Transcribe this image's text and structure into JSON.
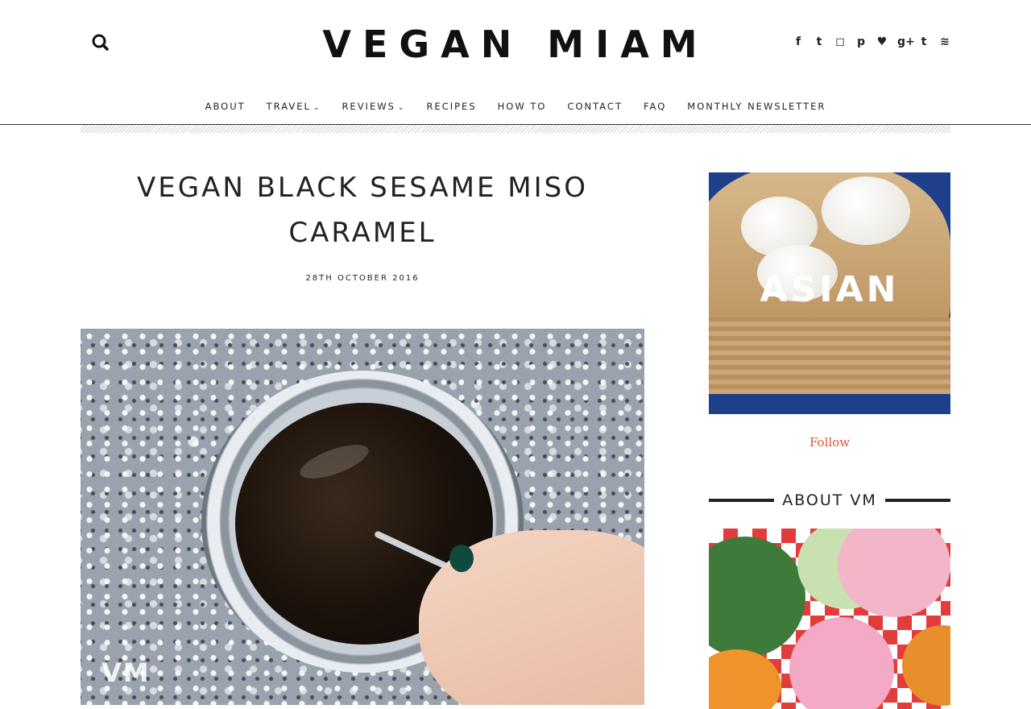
{
  "header": {
    "logo_text": "VEGAN MIAM",
    "search_icon": "search-icon",
    "social_icons": [
      "facebook-icon",
      "twitter-icon",
      "instagram-icon",
      "pinterest-icon",
      "bloglovin-heart-icon",
      "google-plus-icon",
      "tumblr-icon",
      "rss-icon"
    ],
    "social_glyphs": [
      "f",
      "t",
      "◻",
      "p",
      "♥",
      "g+",
      "t",
      "≋"
    ]
  },
  "nav": {
    "items": [
      {
        "label": "ABOUT",
        "dropdown": false
      },
      {
        "label": "TRAVEL",
        "dropdown": true
      },
      {
        "label": "REVIEWS",
        "dropdown": true
      },
      {
        "label": "RECIPES",
        "dropdown": false
      },
      {
        "label": "HOW TO",
        "dropdown": false
      },
      {
        "label": "CONTACT",
        "dropdown": false
      },
      {
        "label": "FAQ",
        "dropdown": false
      },
      {
        "label": "MONTHLY NEWSLETTER",
        "dropdown": false
      }
    ]
  },
  "post": {
    "title": "VEGAN BLACK SESAME MISO CARAMEL",
    "date": "28TH OCTOBER 2016",
    "watermark": "VM"
  },
  "sidebar": {
    "banner_text": "ASIAN",
    "follow_label": "Follow",
    "about_heading": "ABOUT VM"
  },
  "colors": {
    "accent": "#e0553e",
    "text": "#222222",
    "banner_blue": "#1e3f8a"
  }
}
